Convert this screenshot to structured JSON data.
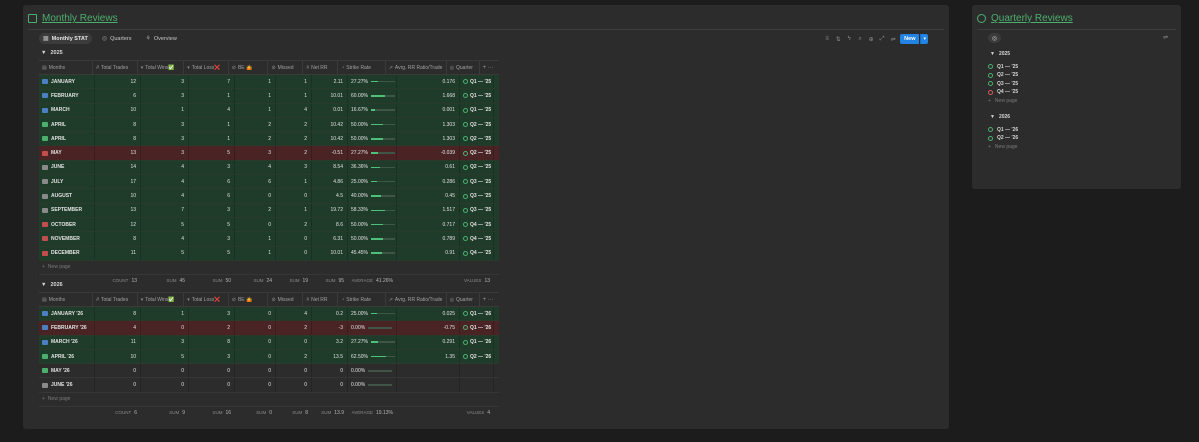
{
  "monthly": {
    "title": "Monthly Reviews",
    "tabs": [
      {
        "label": "Monthly STAT"
      },
      {
        "label": "Quarters"
      },
      {
        "label": "Overview"
      }
    ],
    "new_label": "New",
    "columns": [
      "Months",
      "Total Trades",
      "Total Wins✅",
      "Total Loss❌",
      "BE 🤷",
      "Missed",
      "Net RR",
      "Strike Rate",
      "Avrg. RR Ratio/Trade",
      "Quarter"
    ],
    "new_page_label": "New page",
    "years": [
      {
        "label": "2025",
        "rows": [
          {
            "name": "JANUARY",
            "color": "b",
            "bg": "green",
            "trades": "12",
            "wins": "3",
            "loss": "7",
            "be": "1",
            "missed": "1",
            "netrr": "2.11",
            "strike": "27.27%",
            "strike_val": 27.27,
            "avg": "0.176",
            "q": "Q1 — '25",
            "qstate": "done"
          },
          {
            "name": "FEBRUARY",
            "color": "b",
            "bg": "green",
            "trades": "6",
            "wins": "3",
            "loss": "1",
            "be": "1",
            "missed": "1",
            "netrr": "10.01",
            "strike": "60.00%",
            "strike_val": 60,
            "avg": "1.668",
            "q": "Q1 — '25",
            "qstate": "done"
          },
          {
            "name": "MARCH",
            "color": "b",
            "bg": "green",
            "trades": "10",
            "wins": "1",
            "loss": "4",
            "be": "1",
            "missed": "4",
            "netrr": "0.01",
            "strike": "16.67%",
            "strike_val": 16.67,
            "avg": "0.001",
            "q": "Q1 — '25",
            "qstate": "done"
          },
          {
            "name": "APRIL",
            "color": "gr",
            "bg": "green",
            "trades": "8",
            "wins": "3",
            "loss": "1",
            "be": "2",
            "missed": "2",
            "netrr": "10.42",
            "strike": "50.00%",
            "strike_val": 50,
            "avg": "1.303",
            "q": "Q2 — '25",
            "qstate": "done"
          },
          {
            "name": "APRIL",
            "color": "gr",
            "bg": "green",
            "trades": "8",
            "wins": "3",
            "loss": "1",
            "be": "2",
            "missed": "2",
            "netrr": "10.42",
            "strike": "50.00%",
            "strike_val": 50,
            "avg": "1.303",
            "q": "Q2 — '25",
            "qstate": "done"
          },
          {
            "name": "MAY",
            "color": "r",
            "bg": "red",
            "trades": "13",
            "wins": "3",
            "loss": "5",
            "be": "3",
            "missed": "2",
            "netrr": "-0.51",
            "strike": "27.27%",
            "strike_val": 27.27,
            "avg": "-0.039",
            "q": "Q2 — '25",
            "qstate": "done"
          },
          {
            "name": "JUNE",
            "color": "g",
            "bg": "green",
            "trades": "14",
            "wins": "4",
            "loss": "3",
            "be": "4",
            "missed": "3",
            "netrr": "8.54",
            "strike": "36.36%",
            "strike_val": 36.36,
            "avg": "0.61",
            "q": "Q2 — '25",
            "qstate": "done"
          },
          {
            "name": "JULY",
            "color": "g",
            "bg": "green",
            "trades": "17",
            "wins": "4",
            "loss": "6",
            "be": "6",
            "missed": "1",
            "netrr": "4.86",
            "strike": "25.00%",
            "strike_val": 25,
            "avg": "0.286",
            "q": "Q3 — '25",
            "qstate": "done"
          },
          {
            "name": "AUGUST",
            "color": "g",
            "bg": "green",
            "trades": "10",
            "wins": "4",
            "loss": "6",
            "be": "0",
            "missed": "0",
            "netrr": "4.5",
            "strike": "40.00%",
            "strike_val": 40,
            "avg": "0.45",
            "q": "Q3 — '25",
            "qstate": "done"
          },
          {
            "name": "SEPTEMBER",
            "color": "g",
            "bg": "green",
            "trades": "13",
            "wins": "7",
            "loss": "3",
            "be": "2",
            "missed": "1",
            "netrr": "19.72",
            "strike": "58.33%",
            "strike_val": 58.33,
            "avg": "1.517",
            "q": "Q3 — '25",
            "qstate": "done"
          },
          {
            "name": "OCTOBER",
            "color": "r",
            "bg": "green",
            "trades": "12",
            "wins": "5",
            "loss": "5",
            "be": "0",
            "missed": "2",
            "netrr": "8.6",
            "strike": "50.00%",
            "strike_val": 50,
            "avg": "0.717",
            "q": "Q4 — '25",
            "qstate": "done"
          },
          {
            "name": "NOVEMBER",
            "color": "r",
            "bg": "green",
            "trades": "8",
            "wins": "4",
            "loss": "3",
            "be": "1",
            "missed": "0",
            "netrr": "6.31",
            "strike": "50.00%",
            "strike_val": 50,
            "avg": "0.789",
            "q": "Q4 — '25",
            "qstate": "done"
          },
          {
            "name": "DECEMBER",
            "color": "r",
            "bg": "green",
            "trades": "11",
            "wins": "5",
            "loss": "5",
            "be": "1",
            "missed": "0",
            "netrr": "10.01",
            "strike": "45.45%",
            "strike_val": 45.45,
            "avg": "0.91",
            "q": "Q4 — '25",
            "qstate": "done"
          }
        ],
        "footer": {
          "count": "13",
          "sum_wins": "45",
          "sum_loss": "50",
          "sum_be": "24",
          "sum_missed": "19",
          "sum_netrr": "95",
          "avg_strike": "41.26%",
          "values_q": "13"
        }
      },
      {
        "label": "2026",
        "rows": [
          {
            "name": "JANUARY '26",
            "color": "b",
            "bg": "green",
            "trades": "8",
            "wins": "1",
            "loss": "3",
            "be": "0",
            "missed": "4",
            "netrr": "0.2",
            "strike": "25.00%",
            "strike_val": 25,
            "avg": "0.025",
            "q": "Q1 — '26",
            "qstate": "done"
          },
          {
            "name": "FEBRUARY '26",
            "color": "b",
            "bg": "red",
            "trades": "4",
            "wins": "0",
            "loss": "2",
            "be": "0",
            "missed": "2",
            "netrr": "-3",
            "strike": "0.00%",
            "strike_val": 0,
            "avg": "-0.75",
            "q": "Q1 — '26",
            "qstate": "done"
          },
          {
            "name": "MARCH '26",
            "color": "b",
            "bg": "green",
            "trades": "11",
            "wins": "3",
            "loss": "8",
            "be": "0",
            "missed": "0",
            "netrr": "3.2",
            "strike": "27.27%",
            "strike_val": 27.27,
            "avg": "0.291",
            "q": "Q1 — '26",
            "qstate": "done"
          },
          {
            "name": "APRIL '26",
            "color": "gr",
            "bg": "green",
            "trades": "10",
            "wins": "5",
            "loss": "3",
            "be": "0",
            "missed": "2",
            "netrr": "13.5",
            "strike": "62.50%",
            "strike_val": 62.5,
            "avg": "1.35",
            "q": "Q2 — '26",
            "qstate": "done"
          },
          {
            "name": "MAY '26",
            "color": "gr",
            "bg": "plain",
            "trades": "0",
            "wins": "0",
            "loss": "0",
            "be": "0",
            "missed": "0",
            "netrr": "0",
            "strike": "0.00%",
            "strike_val": 0,
            "avg": "",
            "q": "",
            "qstate": ""
          },
          {
            "name": "JUNE '26",
            "color": "g",
            "bg": "plain",
            "trades": "0",
            "wins": "0",
            "loss": "0",
            "be": "0",
            "missed": "0",
            "netrr": "0",
            "strike": "0.00%",
            "strike_val": 0,
            "avg": "",
            "q": "",
            "qstate": ""
          }
        ],
        "footer": {
          "count": "6",
          "sum_wins": "9",
          "sum_loss": "16",
          "sum_be": "0",
          "sum_missed": "8",
          "sum_netrr": "13.9",
          "avg_strike": "19.13%",
          "values_q": "4"
        }
      }
    ],
    "footer_labels": {
      "count": "COUNT",
      "sum": "SUM",
      "average": "AVERAGE",
      "values": "VALUES"
    }
  },
  "quarterly": {
    "title": "Quarterly Reviews",
    "groups": [
      {
        "label": "2025",
        "items": [
          {
            "label": "Q1 — '25",
            "state": "done"
          },
          {
            "label": "Q2 — '25",
            "state": "done"
          },
          {
            "label": "Q3 — '25",
            "state": "done"
          },
          {
            "label": "Q4 — '25",
            "state": "red"
          }
        ]
      },
      {
        "label": "2026",
        "items": [
          {
            "label": "Q1 — '26",
            "state": "done"
          },
          {
            "label": "Q2 — '26",
            "state": "done"
          }
        ]
      }
    ],
    "new_page_label": "New page"
  }
}
